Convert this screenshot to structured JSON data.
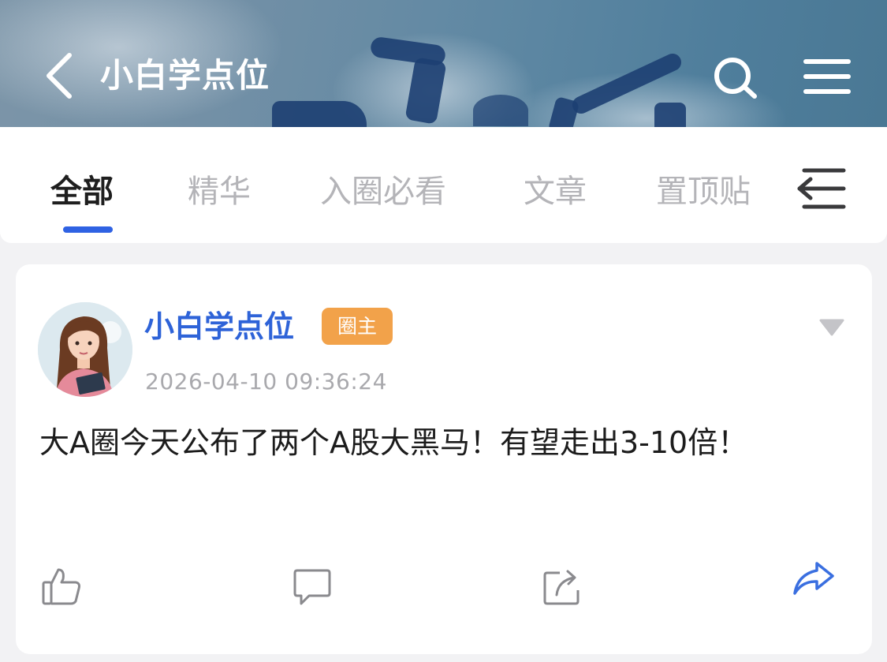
{
  "header": {
    "title": "小白学点位",
    "icons": {
      "back": "chevron-left-icon",
      "search": "search-icon",
      "menu": "hamburger-menu-icon"
    }
  },
  "tabs": [
    {
      "label": "全部",
      "active": true
    },
    {
      "label": "精华",
      "active": false
    },
    {
      "label": "入圈必看",
      "active": false
    },
    {
      "label": "文章",
      "active": false
    },
    {
      "label": "置顶贴",
      "active": false
    }
  ],
  "tabs_more_icon": "collapse-menu-icon",
  "post": {
    "author": "小白学点位",
    "badge": "圈主",
    "timestamp": "2026-04-10 09:36:24",
    "content": "大A圈今天公布了两个A股大黑马！有望走出3-10倍！",
    "actions": [
      "like-icon",
      "comment-icon",
      "share-external-icon",
      "forward-icon"
    ]
  },
  "colors": {
    "accent": "#2f62e3",
    "author_name": "#2e63d8",
    "badge_bg": "#f2a24a",
    "forward_icon": "#3a6fe0",
    "inactive_tab": "#b4b4b8"
  }
}
